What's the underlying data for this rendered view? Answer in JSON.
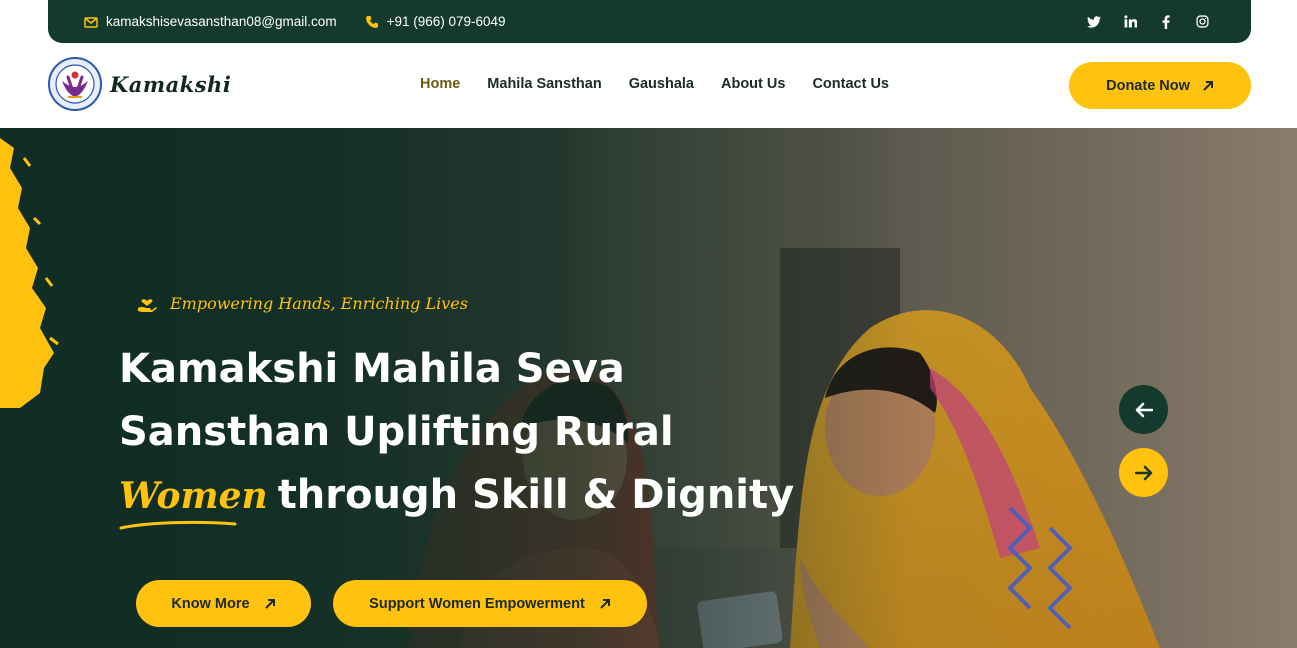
{
  "topbar": {
    "email": "kamakshisevasansthan08@gmail.com",
    "phone": "+91 (966) 079-6049",
    "socials": [
      "twitter-icon",
      "linkedin-icon",
      "facebook-icon",
      "instagram-icon"
    ]
  },
  "brand": {
    "name": "Kamakshi"
  },
  "nav": {
    "items": [
      "Home",
      "Mahila Sansthan",
      "Gaushala",
      "About Us",
      "Contact Us"
    ],
    "active": "Home",
    "donate_label": "Donate Now"
  },
  "hero": {
    "tagline": "Empowering Hands, Enriching Lives",
    "headline_line1": "Kamakshi Mahila Seva",
    "headline_line2": "Sansthan Uplifting Rural",
    "headline_highlight": "Women",
    "headline_line3": "through Skill & Dignity",
    "primary_button": "Know More",
    "secondary_button": "Support Women Empowerment"
  },
  "colors": {
    "dark_green": "#143a2e",
    "accent_yellow": "#ffc20e",
    "white": "#ffffff"
  }
}
